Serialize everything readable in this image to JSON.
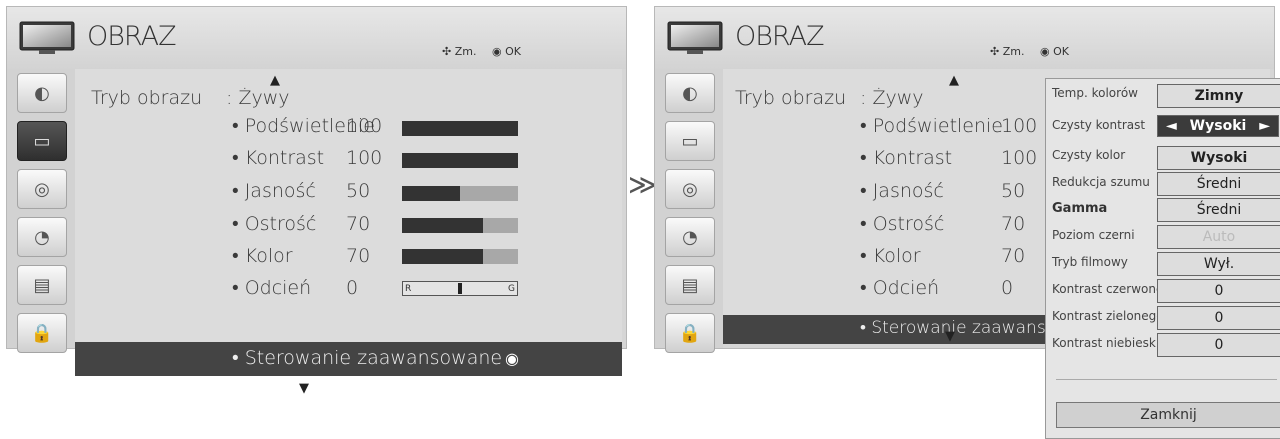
{
  "left": {
    "title": "OBRAZ",
    "hint_move": "Zm.",
    "hint_ok": "OK",
    "mode_label": "Tryb obrazu",
    "mode_value": ": Żywy",
    "items": [
      {
        "label": "• Podświetlenie",
        "value": "100",
        "level": 1.0
      },
      {
        "label": "• Kontrast",
        "value": "100",
        "level": 1.0
      },
      {
        "label": "• Jasność",
        "value": "50",
        "level": 0.5
      },
      {
        "label": "• Ostrość",
        "value": "70",
        "level": 0.7
      },
      {
        "label": "• Kolor",
        "value": "70",
        "level": 0.7
      },
      {
        "label": "• Odcień",
        "value": "0"
      }
    ],
    "tint_left": "R",
    "tint_right": "G",
    "advanced": "• Sterowanie zaawansowane"
  },
  "separator": "≫",
  "right": {
    "title": "OBRAZ",
    "hint_move": "Zm.",
    "hint_ok": "OK",
    "mode_label": "Tryb obrazu",
    "mode_value": ": Żywy",
    "items": [
      {
        "label": "• Podświetlenie",
        "value": "100"
      },
      {
        "label": "• Kontrast",
        "value": "100"
      },
      {
        "label": "• Jasność",
        "value": "50"
      },
      {
        "label": "• Ostrość",
        "value": "70"
      },
      {
        "label": "• Kolor",
        "value": "70"
      },
      {
        "label": "• Odcień",
        "value": "0"
      }
    ],
    "advanced": "• Sterowanie zaawansov"
  },
  "popup": {
    "rows": [
      {
        "label": "Temp. kolorów",
        "value": "Zimny"
      },
      {
        "label": "Czysty kontrast",
        "value": "Wysoki",
        "prev": "◄",
        "next": "►"
      },
      {
        "label": "Czysty kolor",
        "value": "Wysoki"
      },
      {
        "label": "Redukcja szumu",
        "value": "Średni"
      },
      {
        "label": "Gamma",
        "value": "Średni"
      },
      {
        "label": "Poziom czerni",
        "value": "Auto"
      },
      {
        "label": "Tryb filmowy",
        "value": "Wył."
      },
      {
        "label": "Kontrast czerwonego",
        "value": "0"
      },
      {
        "label": "Kontrast zielonego",
        "value": "0"
      },
      {
        "label": "Kontrast niebieskiego",
        "value": "0"
      }
    ],
    "close": "Zamknij"
  },
  "icons": {
    "menu": [
      "picture-settings-icon",
      "tv-screen-icon",
      "speaker-icon",
      "clock-icon",
      "option-icon",
      "lock-icon"
    ]
  }
}
